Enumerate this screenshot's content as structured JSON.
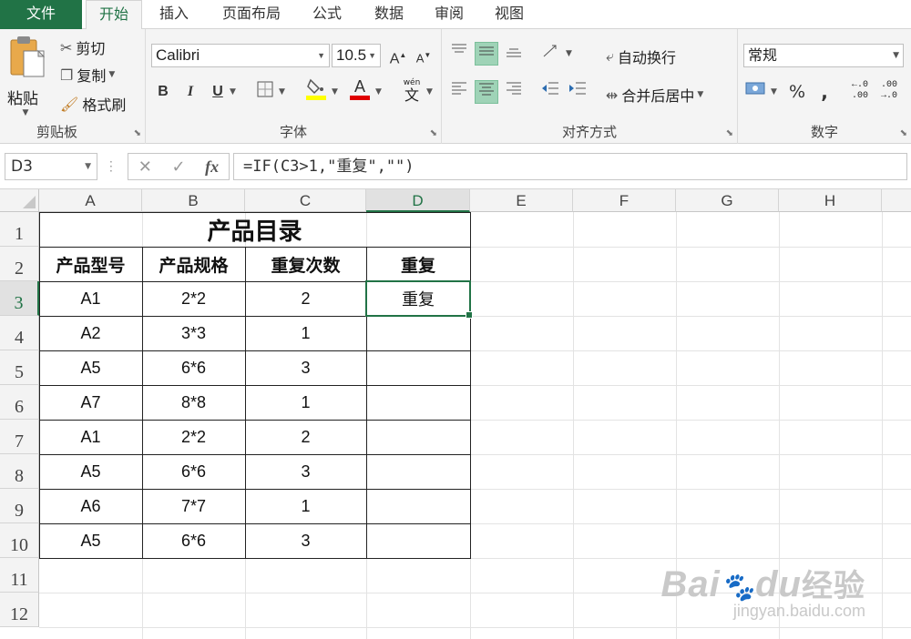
{
  "tabs": [
    {
      "label": "文件"
    },
    {
      "label": "开始"
    },
    {
      "label": "插入"
    },
    {
      "label": "页面布局"
    },
    {
      "label": "公式"
    },
    {
      "label": "数据"
    },
    {
      "label": "审阅"
    },
    {
      "label": "视图"
    }
  ],
  "clipboard": {
    "paste": "粘贴",
    "cut": "剪切",
    "copy": "复制",
    "format_painter": "格式刷",
    "label": "剪贴板"
  },
  "font": {
    "name": "Calibri",
    "size": "10.5",
    "bold": "B",
    "italic": "I",
    "underline": "U",
    "grow": "A",
    "shrink": "A",
    "color_letter": "A",
    "pinyin_top": "wén",
    "pinyin": "文",
    "label": "字体",
    "fill_color": "#ffff00",
    "font_color": "#e00000"
  },
  "alignment": {
    "wrap": "自动换行",
    "merge": "合并后居中",
    "label": "对齐方式"
  },
  "number": {
    "format": "常规",
    "percent": "%",
    "comma": ",",
    "inc_top": "←.0",
    "inc_bottom": ".00",
    "dec_top": ".00",
    "dec_bottom": "→.0",
    "label": "数字"
  },
  "formula_bar": {
    "name_box": "D3",
    "cancel": "✕",
    "enter": "✓",
    "fx": "fx",
    "formula": "=IF(C3>1,\"重复\",\"\")"
  },
  "columns": [
    "A",
    "B",
    "C",
    "D",
    "E",
    "F",
    "G",
    "H"
  ],
  "rows": [
    "1",
    "2",
    "3",
    "4",
    "5",
    "6",
    "7",
    "8",
    "9",
    "10",
    "11",
    "12"
  ],
  "sheet": {
    "title": "产品目录",
    "headers": [
      "产品型号",
      "产品规格",
      "重复次数",
      "重复"
    ],
    "data": [
      [
        "A1",
        "2*2",
        "2",
        "重复"
      ],
      [
        "A2",
        "3*3",
        "1",
        ""
      ],
      [
        "A5",
        "6*6",
        "3",
        ""
      ],
      [
        "A7",
        "8*8",
        "1",
        ""
      ],
      [
        "A1",
        "2*2",
        "2",
        ""
      ],
      [
        "A5",
        "6*6",
        "3",
        ""
      ],
      [
        "A6",
        "7*7",
        "1",
        ""
      ],
      [
        "A5",
        "6*6",
        "3",
        ""
      ]
    ]
  },
  "watermark": {
    "brand": "Bai",
    "brand2": "du",
    "cn": "经验",
    "url": "jingyan.baidu.com"
  },
  "accent_color": "#217346"
}
